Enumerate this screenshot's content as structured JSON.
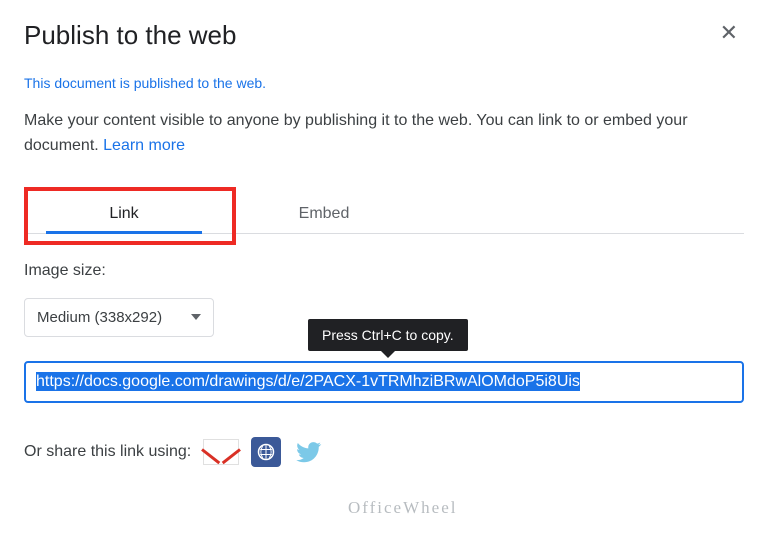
{
  "dialog": {
    "title": "Publish to the web",
    "status": "This document is published to the web.",
    "description_lead": "Make your content visible to anyone by publishing it to the web. You can link to or embed your document. ",
    "learn_more": "Learn more"
  },
  "tabs": {
    "link": "Link",
    "embed": "Embed",
    "active": "link"
  },
  "image_size": {
    "label": "Image size:",
    "selected": "Medium (338x292)"
  },
  "tooltip": "Press Ctrl+C to copy.",
  "url": "https://docs.google.com/drawings/d/e/2PACX-1vTRMhziBRwAlOMdoP5i8Uis",
  "share": {
    "label": "Or share this link using:"
  },
  "icons": {
    "close": "✕",
    "gmail": "gmail-icon",
    "facebook": "facebook-icon",
    "twitter": "twitter-icon"
  },
  "watermark": "OfficeWheel"
}
